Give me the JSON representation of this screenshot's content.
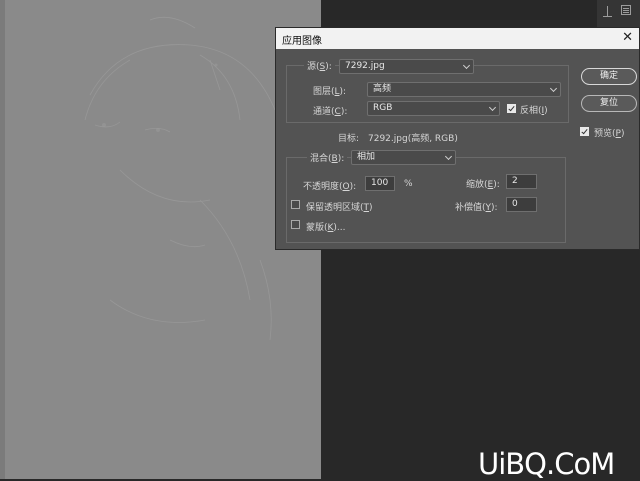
{
  "dialog": {
    "title": "应用图像",
    "close_symbol": "✕",
    "source": {
      "label_prefix": "源(",
      "label_key": "S",
      "label_suffix": "):",
      "value": "7292.jpg"
    },
    "layer": {
      "label_prefix": "图层(",
      "label_key": "L",
      "label_suffix": "):",
      "value": "高频"
    },
    "channel": {
      "label_prefix": "通道(",
      "label_key": "C",
      "label_suffix": "):",
      "value": "RGB"
    },
    "invert": {
      "label_prefix": "反相(",
      "label_key": "I",
      "label_suffix": ")",
      "checked": true
    },
    "target": {
      "label": "目标:",
      "value": "7292.jpg(高频, RGB)"
    },
    "blending": {
      "label_prefix": "混合(",
      "label_key": "B",
      "label_suffix": "):",
      "value": "相加"
    },
    "opacity": {
      "label_prefix": "不透明度(",
      "label_key": "O",
      "label_suffix": "):",
      "value": "100",
      "unit": "%"
    },
    "scale": {
      "label_prefix": "缩放(",
      "label_key": "E",
      "label_suffix": "):",
      "value": "2"
    },
    "offset": {
      "label_prefix": "补偿值(",
      "label_key": "Y",
      "label_suffix": "):",
      "value": "0"
    },
    "preserve_transparency": {
      "label_prefix": "保留透明区域(",
      "label_key": "T",
      "label_suffix": ")",
      "checked": false
    },
    "mask": {
      "label_prefix": "蒙版(",
      "label_key": "K",
      "label_suffix": ")...",
      "checked": false
    },
    "ok_label": "确定",
    "reset_label": "复位",
    "preview": {
      "label_prefix": "预览(",
      "label_key": "P",
      "label_suffix": ")",
      "checked": true
    }
  },
  "watermark": "UiBQ.CoM",
  "colors": {
    "canvas_gray": "#8a8a8a",
    "dialog_bg": "#535353",
    "titlebar_bg": "#f2f2f2",
    "app_bg": "#282828"
  }
}
